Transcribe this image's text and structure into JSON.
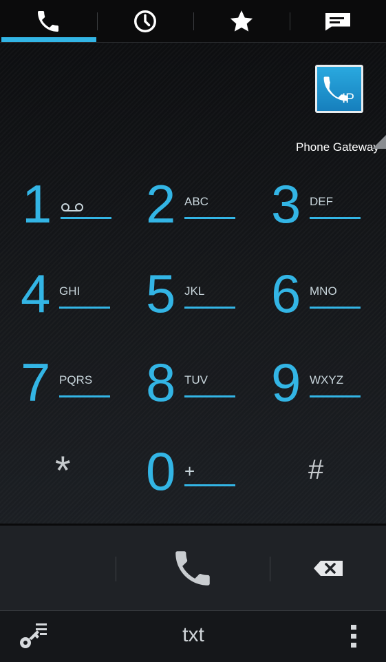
{
  "tabs": [
    {
      "name": "phone-icon",
      "active": true
    },
    {
      "name": "clock-icon",
      "active": false
    },
    {
      "name": "star-icon",
      "active": false
    },
    {
      "name": "message-icon",
      "active": false
    }
  ],
  "gateway": {
    "icon_text": "IP",
    "label": "Phone Gateway"
  },
  "keys": [
    {
      "digit": "1",
      "letters": ""
    },
    {
      "digit": "2",
      "letters": "ABC"
    },
    {
      "digit": "3",
      "letters": "DEF"
    },
    {
      "digit": "4",
      "letters": "GHI"
    },
    {
      "digit": "5",
      "letters": "JKL"
    },
    {
      "digit": "6",
      "letters": "MNO"
    },
    {
      "digit": "7",
      "letters": "PQRS"
    },
    {
      "digit": "8",
      "letters": "TUV"
    },
    {
      "digit": "9",
      "letters": "WXYZ"
    },
    {
      "digit": "0",
      "letters": "+"
    }
  ],
  "symbols": {
    "star": "*",
    "hash": "#"
  },
  "bottom": {
    "txt_label": "txt"
  },
  "colors": {
    "accent": "#33b5e5"
  }
}
